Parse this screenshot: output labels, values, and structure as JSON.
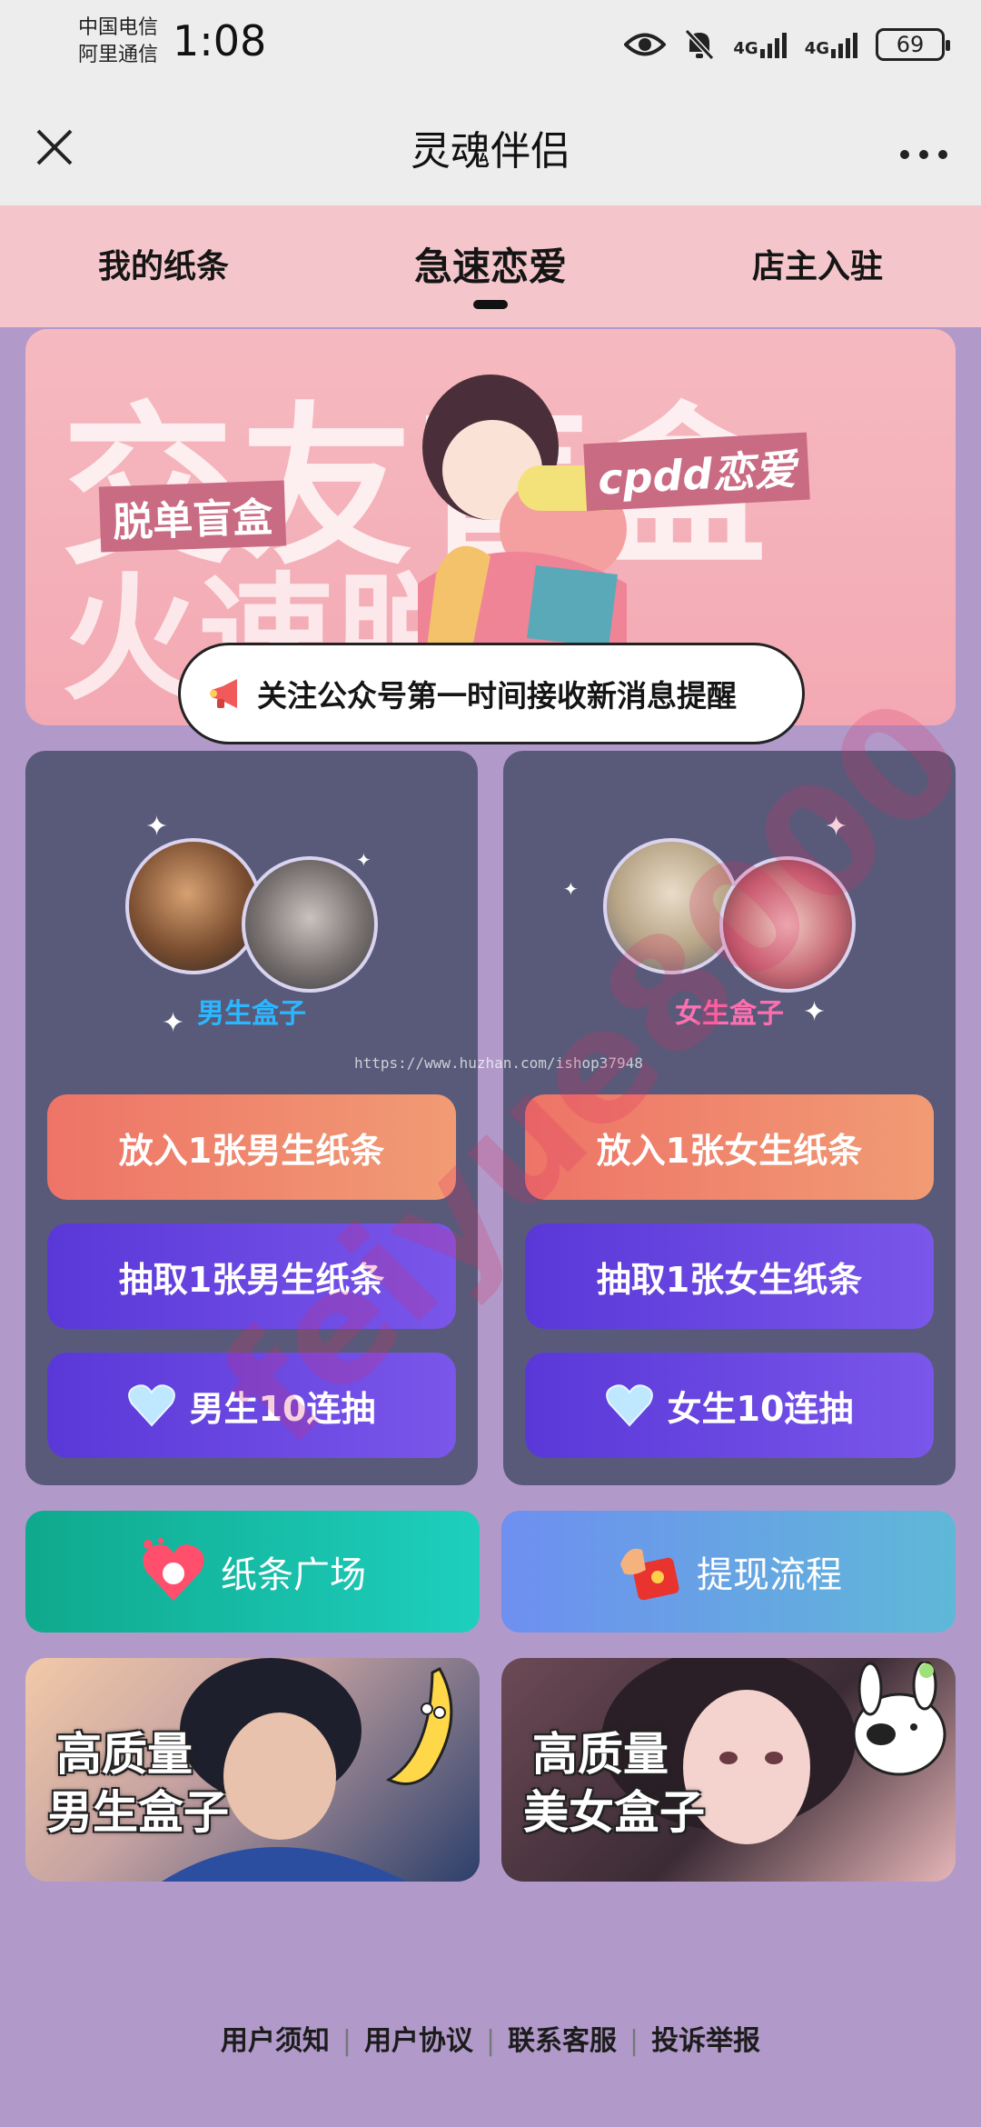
{
  "status_bar": {
    "carrier_1": "中国电信",
    "carrier_2": "阿里通信",
    "time": "1:08",
    "network_1": "4G",
    "network_2": "4G",
    "battery": "69"
  },
  "title_bar": {
    "title": "灵魂伴侣"
  },
  "tabs": {
    "items": [
      {
        "label": "我的纸条"
      },
      {
        "label": "急速恋爱"
      },
      {
        "label": "店主入驻"
      }
    ],
    "active_index": 1
  },
  "banner": {
    "bg_text_top": "交友盲盒",
    "bg_text_bottom": "火速脱单",
    "tag_left": "脱单盲盒",
    "tag_right": "cpdd恋爱",
    "notice": "关注公众号第一时间接收新消息提醒"
  },
  "boy_panel": {
    "label": "男生盒子",
    "label_color": "#2bb7ff",
    "put_button": "放入1张男生纸条",
    "draw_button": "抽取1张男生纸条",
    "draw10_button": "男生10连抽"
  },
  "girl_panel": {
    "label": "女生盒子",
    "label_color": "#ff6fb0",
    "put_button": "放入1张女生纸条",
    "draw_button": "抽取1张女生纸条",
    "draw10_button": "女生10连抽"
  },
  "features": {
    "square": "纸条广场",
    "withdraw": "提现流程"
  },
  "promos": {
    "boy": {
      "line1": "高质量",
      "line2": "男生盒子"
    },
    "girl": {
      "line1": "高质量",
      "line2": "美女盒子"
    }
  },
  "watermark": {
    "url": "https://www.huzhan.com/ishop37948",
    "text": "feiyue8000"
  },
  "footer": {
    "links": [
      "用户须知",
      "用户协议",
      "联系客服",
      "投诉举报"
    ]
  }
}
